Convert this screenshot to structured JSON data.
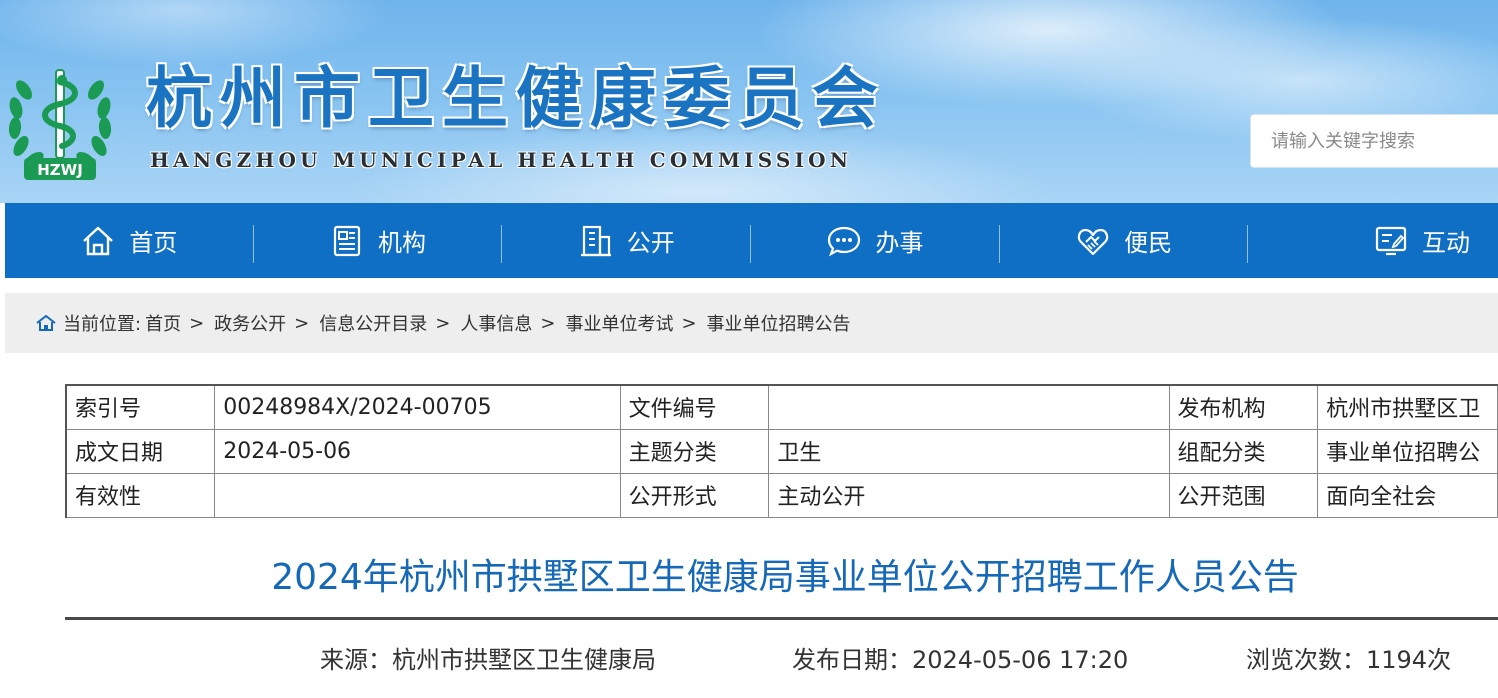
{
  "header": {
    "logo_text": "HZWJ",
    "title": "杭州市卫生健康委员会",
    "subtitle": "HANGZHOU MUNICIPAL HEALTH COMMISSION",
    "search_placeholder": "请输入关键字搜索"
  },
  "nav": {
    "items": [
      {
        "label": "首页",
        "icon": "home-icon"
      },
      {
        "label": "机构",
        "icon": "document-icon"
      },
      {
        "label": "公开",
        "icon": "building-icon"
      },
      {
        "label": "办事",
        "icon": "chat-bubble-icon"
      },
      {
        "label": "便民",
        "icon": "heart-hands-icon"
      },
      {
        "label": "互动",
        "icon": "feedback-icon"
      }
    ]
  },
  "breadcrumb": {
    "label": "当前位置:",
    "items": [
      "首页",
      "政务公开",
      "信息公开目录",
      "人事信息",
      "事业单位考试",
      "事业单位招聘公告"
    ],
    "separator": ">"
  },
  "meta": {
    "rows": [
      [
        "索引号",
        "00248984X/2024-00705",
        "文件编号",
        "",
        "发布机构",
        "杭州市拱墅区卫"
      ],
      [
        "成文日期",
        "2024-05-06",
        "主题分类",
        "卫生",
        "组配分类",
        "事业单位招聘公"
      ],
      [
        "有效性",
        "",
        "公开形式",
        "主动公开",
        "公开范围",
        "面向全社会"
      ]
    ]
  },
  "article": {
    "title": "2024年杭州市拱墅区卫生健康局事业单位公开招聘工作人员公告",
    "source": "来源：杭州市拱墅区卫生健康局",
    "publish_date": "发布日期：2024-05-06 17:20",
    "views": "浏览次数：1194次"
  },
  "colors": {
    "nav_bg": "#0e6fc4",
    "title_blue": "#1b74c2",
    "article_title": "#1669b8",
    "logo_green": "#1a9a52"
  }
}
